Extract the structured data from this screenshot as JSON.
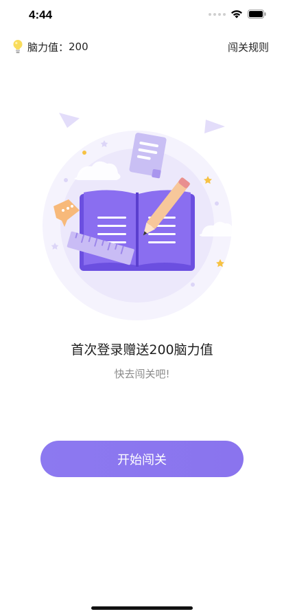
{
  "status_bar": {
    "time": "4:44"
  },
  "header": {
    "brain_label": "脑力值：",
    "brain_value": "200",
    "rules_label": "闯关规则"
  },
  "main": {
    "headline": "首次登录赠送200脑力值",
    "subline": "快去闯关吧!",
    "start_button_label": "开始闯关"
  },
  "colors": {
    "accent": "#8c79f0",
    "book": "#7b5ee8",
    "circle_bg": "#efecfb"
  },
  "icons": [
    "lightbulb-icon",
    "wifi-icon",
    "battery-icon",
    "book-illustration"
  ]
}
